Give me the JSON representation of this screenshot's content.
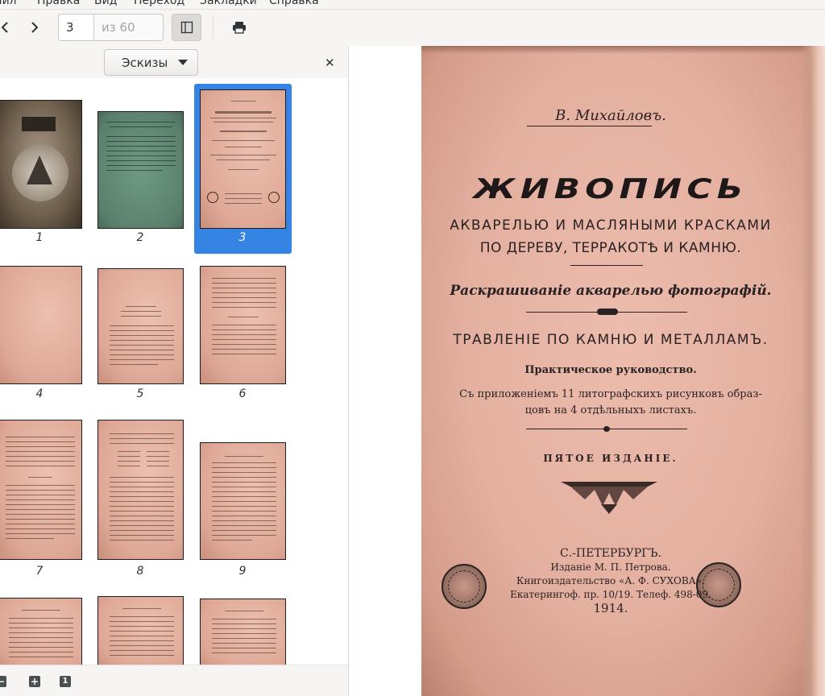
{
  "menubar": {
    "items": [
      "айл",
      "Правка",
      "Вид",
      "Переход",
      "Закладки",
      "Справка"
    ]
  },
  "toolbar": {
    "page_current": "3",
    "page_total": "из 60"
  },
  "sidebar": {
    "view_select": "Эскизы",
    "selected_page": 3,
    "thumbnails": [
      "1",
      "2",
      "3",
      "4",
      "5",
      "6",
      "7",
      "8",
      "9"
    ]
  },
  "book_page": {
    "author": "В. Михайловъ.",
    "title": "ЖИВОПИСЬ",
    "subtitle_1": "АКВАРЕЛЬЮ И МАСЛЯНЫМИ КРАСКАМИ",
    "subtitle_2": "ПО ДЕРЕВУ, ТЕРРАКОТѢ И КАМНЮ.",
    "subtitle_3": "Раскрашиваніе акварелью фотографій.",
    "subtitle_4": "ТРАВЛЕНІЕ ПО КАМНЮ И МЕТАЛЛАМЪ.",
    "subtitle_5": "Практическое руководство.",
    "subtitle_6a": "Съ приложеніемъ 11 литографскихъ рисунковъ образ-",
    "subtitle_6b": "цовъ на 4 отдѣльныхъ листахъ.",
    "edition": "ПЯТОЕ ИЗДАНІЕ.",
    "imprint_city": "С.-ПЕТЕРБУРГЪ.",
    "imprint_publisher": "Изданіе М. П. Петрова.",
    "imprint_bookseller": "Книгоиздательство «А. Ф. СУХОВА».",
    "imprint_address": "Екатерингоф. пр. 10/19. Телеф. 498-09.",
    "imprint_year": "1914."
  },
  "colors": {
    "accent": "#3584e4",
    "page_tint": "#e4b0a0"
  }
}
